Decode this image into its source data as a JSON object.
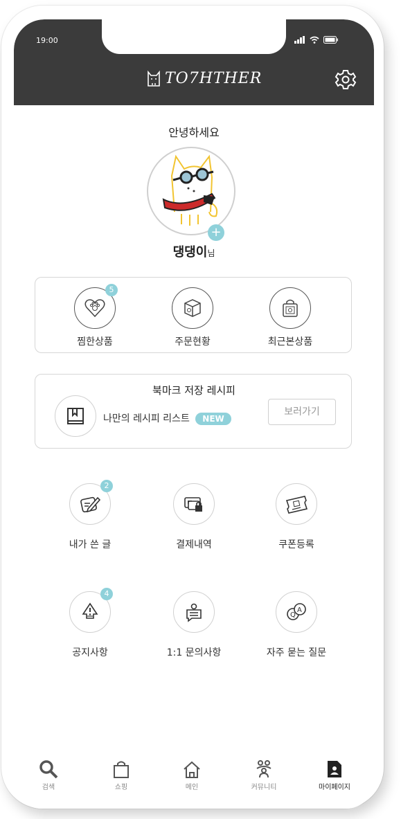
{
  "status_bar": {
    "time": "19:00"
  },
  "header": {
    "logo": "TO7HTHER"
  },
  "profile": {
    "greeting": "안녕하세요",
    "nickname": "댕댕이",
    "suffix": "님"
  },
  "quick": [
    {
      "label": "찜한상품",
      "badge": "5",
      "icon": "heart-paw-icon"
    },
    {
      "label": "주문현황",
      "badge": "",
      "icon": "box-icon"
    },
    {
      "label": "최근본상품",
      "badge": "",
      "icon": "shopping-bag-icon"
    }
  ],
  "bookmark": {
    "title": "북마크 저장 레시피",
    "subtitle": "나만의 레시피 리스트",
    "new_badge": "NEW",
    "button": "보러가기"
  },
  "menu": [
    {
      "label": "내가 쓴 글",
      "badge": "2",
      "icon": "pencil-note-icon"
    },
    {
      "label": "결제내역",
      "badge": "",
      "icon": "card-lock-icon"
    },
    {
      "label": "쿠폰등록",
      "badge": "",
      "icon": "ticket-icon"
    },
    {
      "label": "공지사항",
      "badge": "4",
      "icon": "alert-bubble-icon"
    },
    {
      "label": "1:1 문의사항",
      "badge": "",
      "icon": "person-chat-icon"
    },
    {
      "label": "자주 묻는 질문",
      "badge": "",
      "icon": "qa-bubble-icon"
    }
  ],
  "nav": [
    {
      "label": "검색",
      "icon": "search-icon"
    },
    {
      "label": "쇼핑",
      "icon": "shopping-bag-icon"
    },
    {
      "label": "메인",
      "icon": "home-icon"
    },
    {
      "label": "커뮤니티",
      "icon": "community-icon"
    },
    {
      "label": "마이페이지",
      "icon": "mypage-icon",
      "active": true
    }
  ],
  "colors": {
    "header": "#3b3b3b",
    "accent": "#8fd1da"
  }
}
